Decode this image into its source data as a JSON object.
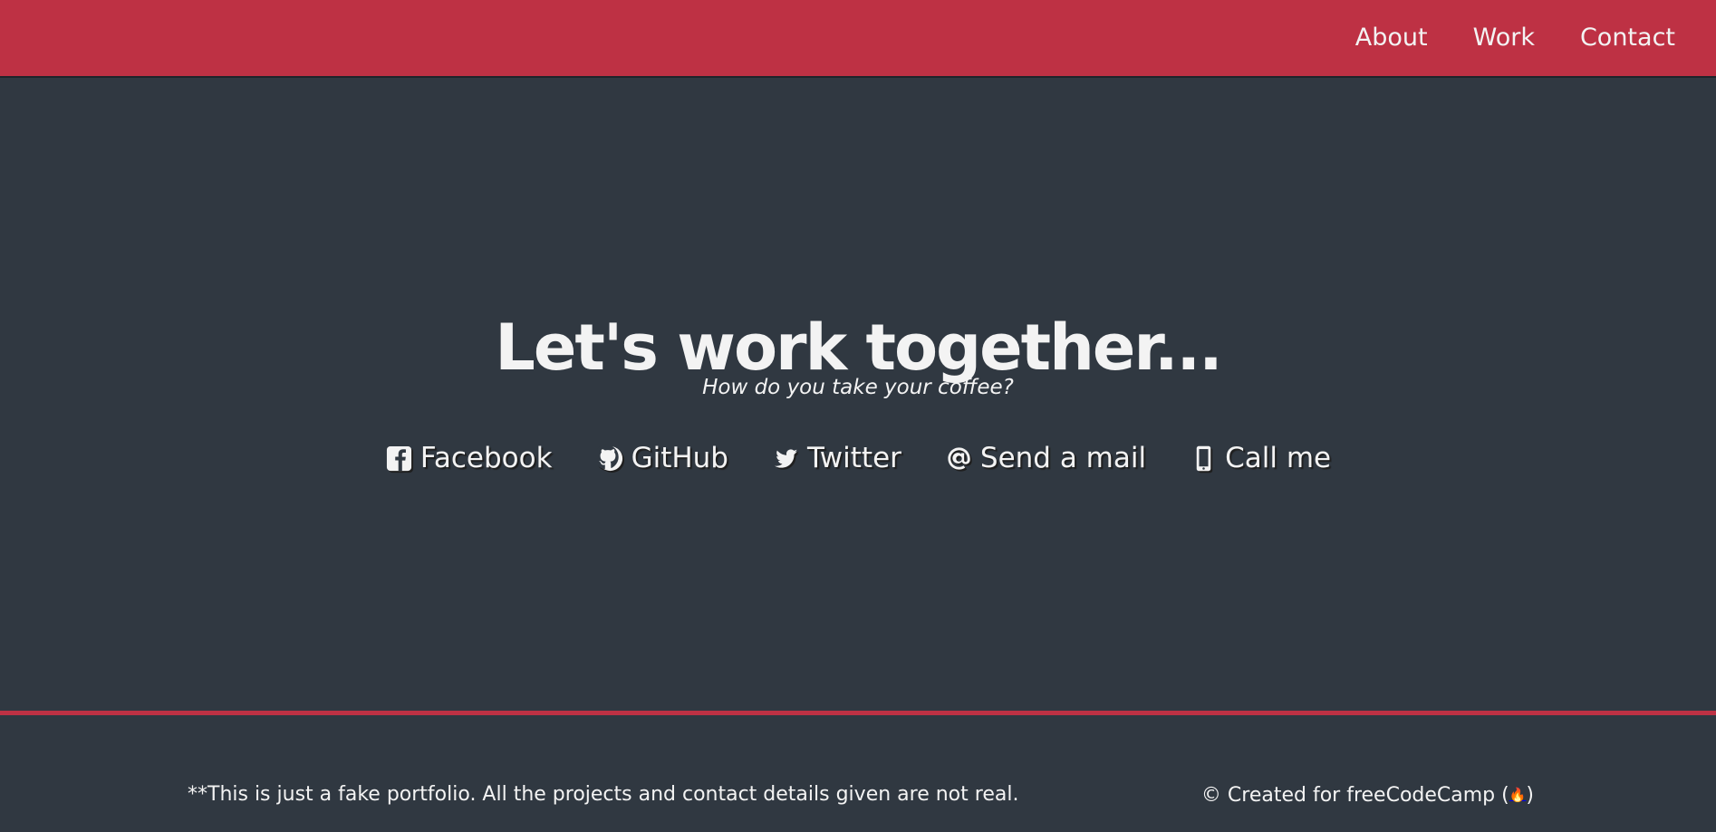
{
  "navigation": {
    "items": [
      {
        "label": "About"
      },
      {
        "label": "Work"
      },
      {
        "label": "Contact"
      }
    ]
  },
  "hero": {
    "title": "Let's work together...",
    "subtitle": "How do you take your coffee?"
  },
  "contacts": [
    {
      "label": "Facebook",
      "icon": "facebook-icon"
    },
    {
      "label": "GitHub",
      "icon": "github-icon"
    },
    {
      "label": "Twitter",
      "icon": "twitter-icon"
    },
    {
      "label": "Send a mail",
      "icon": "at-icon"
    },
    {
      "label": "Call me",
      "icon": "mobile-phone-icon"
    }
  ],
  "footer": {
    "disclaimer": "**This is just a fake portfolio. All the projects and contact details given are not real.",
    "credit_prefix": "© Created for freeCodeCamp (",
    "credit_icon": "🔥",
    "credit_suffix": ")"
  },
  "colors": {
    "accent": "#be3144",
    "background": "#303841",
    "text": "#f3f3f3"
  }
}
